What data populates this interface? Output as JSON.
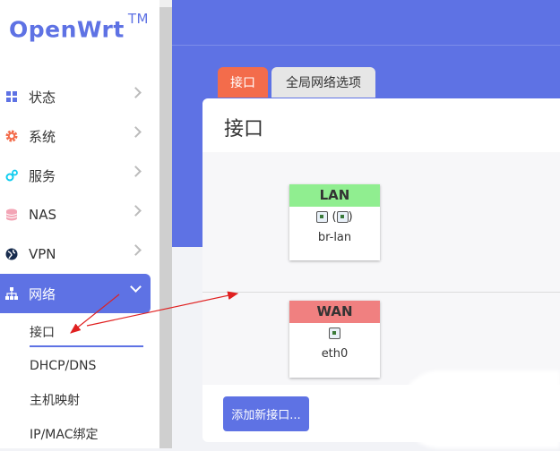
{
  "logo": {
    "text": "OpenWrt",
    "tm": "TM"
  },
  "sidebar": {
    "items": [
      {
        "label": "状态",
        "icon": "dashboard-icon"
      },
      {
        "label": "系统",
        "icon": "gear-icon"
      },
      {
        "label": "服务",
        "icon": "services-icon"
      },
      {
        "label": "NAS",
        "icon": "database-icon"
      },
      {
        "label": "VPN",
        "icon": "globe-icon"
      },
      {
        "label": "网络",
        "icon": "network-icon"
      }
    ],
    "sub_items": [
      {
        "label": "接口"
      },
      {
        "label": "DHCP/DNS"
      },
      {
        "label": "主机映射"
      },
      {
        "label": "IP/MAC绑定"
      }
    ]
  },
  "tabs": [
    {
      "label": "接口"
    },
    {
      "label": "全局网络选项"
    }
  ],
  "page": {
    "title": "接口",
    "networks": [
      {
        "name": "LAN",
        "icons_text": "(",
        "icons_close": ")",
        "device": "br-lan",
        "color": "#90ee90"
      },
      {
        "name": "WAN",
        "device": "eth0",
        "color": "#f08080"
      }
    ],
    "add_button": "添加新接口..."
  },
  "colors": {
    "accent": "#5e72e4",
    "tab_active": "#f36c4b",
    "annotation": "#e02020"
  }
}
